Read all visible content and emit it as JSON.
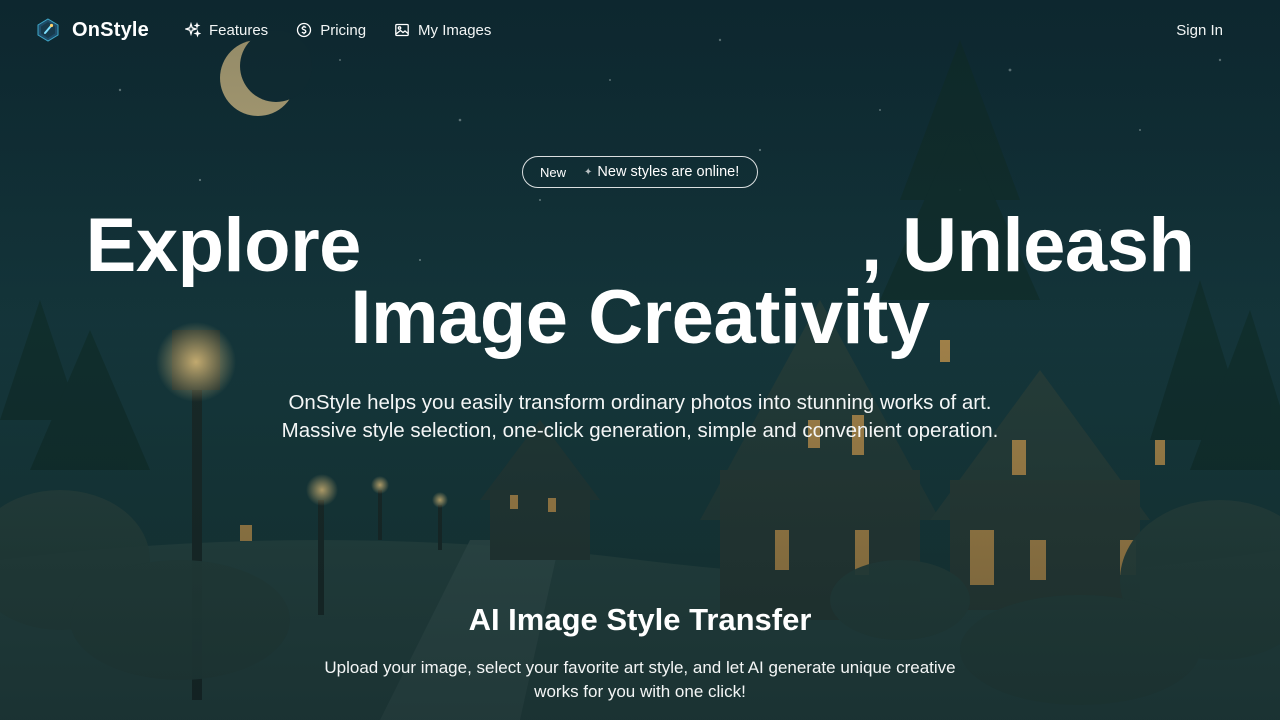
{
  "brand": {
    "name": "OnStyle"
  },
  "nav": {
    "links": [
      {
        "label": "Features",
        "icon": "sparkles-icon"
      },
      {
        "label": "Pricing",
        "icon": "coin-icon"
      },
      {
        "label": "My Images",
        "icon": "image-icon"
      }
    ],
    "sign_in": "Sign In"
  },
  "hero": {
    "badge_tag": "New",
    "badge_text": "New styles are online!",
    "headline_part1": "Explore",
    "headline_part2": ", Unleash",
    "headline_line2": "Image Creativity",
    "subtitle_line1": "OnStyle helps you easily transform ordinary photos into stunning works of art.",
    "subtitle_line2": "Massive style selection, one-click generation, simple and convenient operation."
  },
  "section": {
    "title": "AI Image Style Transfer",
    "desc_line1": "Upload your image, select your favorite art style, and let AI generate unique creative",
    "desc_line2": "works for you with one click!"
  },
  "colors": {
    "background": "#0e2a2e",
    "text": "#ffffff",
    "lamp_glow": "#f4c06a"
  }
}
